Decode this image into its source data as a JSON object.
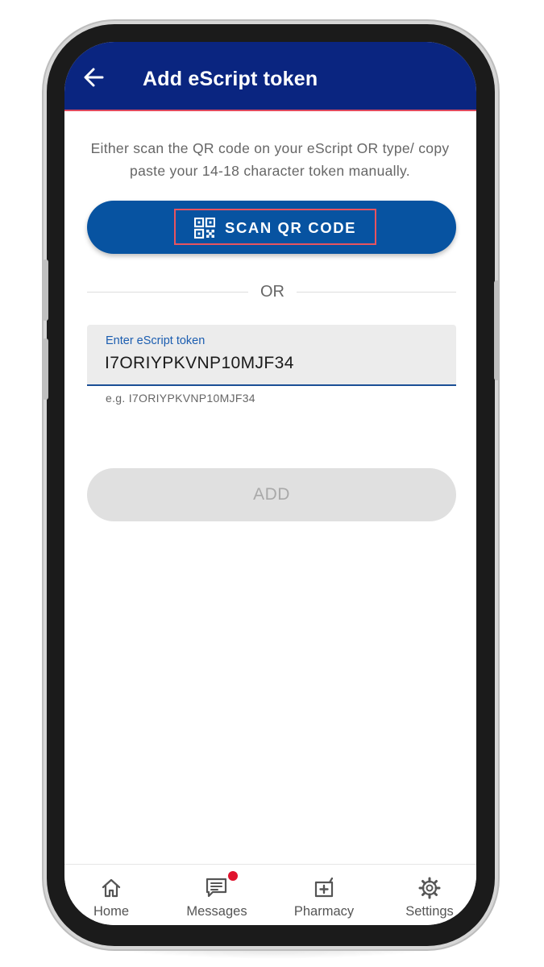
{
  "header": {
    "back_icon": "arrow-left-icon",
    "title": "Add eScript token"
  },
  "instructions": "Either scan the QR code on your eScript OR type/ copy paste your 14-18 character token manually.",
  "scan_button": {
    "icon": "qr-code-icon",
    "label": "SCAN QR CODE"
  },
  "divider_text": "OR",
  "token_input": {
    "label": "Enter eScript token",
    "value": "I7ORIYPKVNP10MJF34",
    "helper": "e.g. I7ORIYPKVNP10MJF34"
  },
  "add_button": {
    "label": "ADD",
    "state": "disabled"
  },
  "bottom_nav": {
    "items": [
      {
        "label": "Home",
        "icon": "home-icon"
      },
      {
        "label": "Messages",
        "icon": "messages-icon",
        "badge": true
      },
      {
        "label": "Pharmacy",
        "icon": "pharmacy-icon"
      },
      {
        "label": "Settings",
        "icon": "gear-icon"
      }
    ]
  },
  "colors": {
    "header_bg": "#0a2580",
    "primary_button": "#0753a1",
    "highlight_border": "#e8545f",
    "badge": "#e0132d",
    "disabled_button": "#e0e0e0"
  }
}
